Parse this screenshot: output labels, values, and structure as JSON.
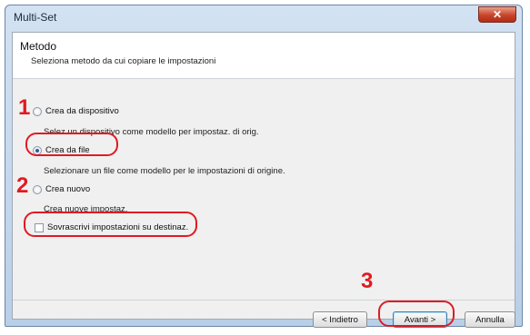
{
  "window": {
    "title": "Multi-Set",
    "close_glyph": "✕"
  },
  "header": {
    "title": "Metodo",
    "subtitle": "Seleziona metodo da cui copiare le impostazioni"
  },
  "options": [
    {
      "label": "Crea da dispositivo",
      "description": "Selez.un dispositivo come modello per impostaz. di orig.",
      "selected": false
    },
    {
      "label": "Crea da file",
      "description": "Selezionare un file come modello per le impostazioni di origine.",
      "selected": true
    },
    {
      "label": "Crea nuovo",
      "description": "Crea nuove impostaz.",
      "selected": false
    }
  ],
  "overwrite": {
    "label": "Sovrascrivi impostazioni su destinaz.",
    "checked": false
  },
  "buttons": {
    "back": "< Indietro",
    "next": "Avanti >",
    "cancel": "Annulla"
  },
  "callouts": {
    "one": "1",
    "two": "2",
    "three": "3"
  },
  "colors": {
    "callout": "#e01a22"
  }
}
